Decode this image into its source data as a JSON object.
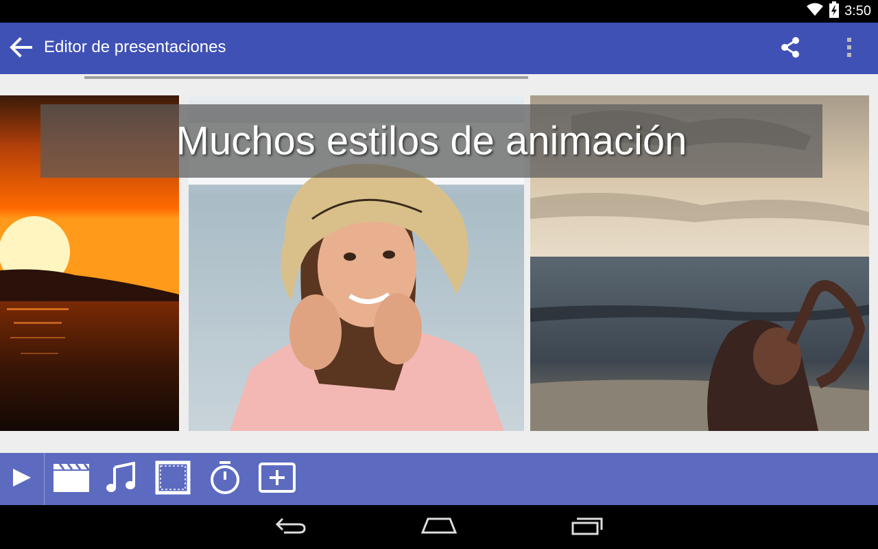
{
  "status_bar": {
    "time": "3:50",
    "icons": [
      "wifi-icon",
      "battery-charging-icon"
    ]
  },
  "app_bar": {
    "title": "Editor de presentaciones",
    "icons": [
      "arrow-back-icon",
      "share-icon",
      "more-vert-icon"
    ],
    "color": "#3f51b5"
  },
  "slides": [
    {
      "name": "sunset-slide"
    },
    {
      "name": "girl-hat-slide"
    },
    {
      "name": "beach-heart-slide"
    }
  ],
  "caption": {
    "text": "Muchos estilos de animación"
  },
  "bottom_toolbar": {
    "color": "#5c6bc0",
    "tools": [
      "play-icon",
      "movie-clapper-icon",
      "music-note-icon",
      "frame-border-icon",
      "timer-icon",
      "add-box-icon"
    ]
  },
  "nav_bar": {
    "icons": [
      "nav-back-icon",
      "nav-home-icon",
      "nav-recents-icon"
    ]
  }
}
